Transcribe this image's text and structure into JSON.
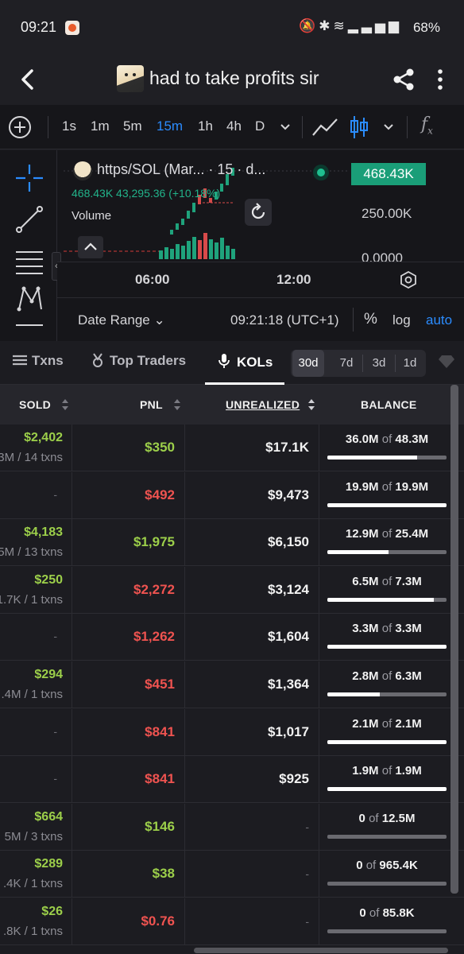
{
  "status": {
    "time": "09:21",
    "battery": "68%"
  },
  "header": {
    "title": "had to take profits sir"
  },
  "toolbar": {
    "timeframes": [
      "1s",
      "1m",
      "5m",
      "15m",
      "1h",
      "4h",
      "D"
    ],
    "active_timeframe": "15m"
  },
  "chart": {
    "legend_name": "https/SOL (Mar...  · 15 · d...",
    "legend_values": "468.43K  43,295.36 (+10.18%)",
    "volume_label": "Volume",
    "price_tag": "468.43K",
    "y_axis": [
      "250.00K",
      "0.0000"
    ],
    "time_axis": [
      "06:00",
      "12:00"
    ],
    "date_range": "Date Range",
    "clock": "09:21:18 (UTC+1)",
    "percent": "%",
    "log": "log",
    "auto": "auto",
    "accent": "#2b8cff",
    "up_color": "#1fbf8f",
    "down_color": "#ef5350"
  },
  "tabs": {
    "items": [
      "Txns",
      "Top Traders",
      "KOLs"
    ],
    "active": "KOLs",
    "periods": [
      "30d",
      "7d",
      "3d",
      "1d"
    ],
    "active_period": "30d"
  },
  "table": {
    "headers": {
      "sold": "SOLD",
      "pnl": "PNL",
      "unrealized": "UNREALIZED",
      "balance": "BALANCE"
    },
    "of_word": "of",
    "rows": [
      {
        "sold": "$2,402",
        "sold_sub": "3M / 14 txns",
        "pnl": "$350",
        "pnl_sign": "pos",
        "unrealized": "$17.1K",
        "bal_held": "36.0M",
        "bal_total": "48.3M",
        "bal_frac": 0.75
      },
      {
        "sold": "-",
        "sold_sub": "",
        "pnl": "$492",
        "pnl_sign": "neg",
        "unrealized": "$9,473",
        "bal_held": "19.9M",
        "bal_total": "19.9M",
        "bal_frac": 1.0
      },
      {
        "sold": "$4,183",
        "sold_sub": "5M / 13 txns",
        "pnl": "$1,975",
        "pnl_sign": "pos",
        "unrealized": "$6,150",
        "bal_held": "12.9M",
        "bal_total": "25.4M",
        "bal_frac": 0.51
      },
      {
        "sold": "$250",
        "sold_sub": "1.7K / 1 txns",
        "pnl": "$2,272",
        "pnl_sign": "neg",
        "unrealized": "$3,124",
        "bal_held": "6.5M",
        "bal_total": "7.3M",
        "bal_frac": 0.89
      },
      {
        "sold": "-",
        "sold_sub": "",
        "pnl": "$1,262",
        "pnl_sign": "neg",
        "unrealized": "$1,604",
        "bal_held": "3.3M",
        "bal_total": "3.3M",
        "bal_frac": 1.0
      },
      {
        "sold": "$294",
        "sold_sub": ".4M / 1 txns",
        "pnl": "$451",
        "pnl_sign": "neg",
        "unrealized": "$1,364",
        "bal_held": "2.8M",
        "bal_total": "6.3M",
        "bal_frac": 0.44
      },
      {
        "sold": "-",
        "sold_sub": "",
        "pnl": "$841",
        "pnl_sign": "neg",
        "unrealized": "$1,017",
        "bal_held": "2.1M",
        "bal_total": "2.1M",
        "bal_frac": 1.0
      },
      {
        "sold": "-",
        "sold_sub": "",
        "pnl": "$841",
        "pnl_sign": "neg",
        "unrealized": "$925",
        "bal_held": "1.9M",
        "bal_total": "1.9M",
        "bal_frac": 1.0
      },
      {
        "sold": "$664",
        "sold_sub": "5M / 3 txns",
        "pnl": "$146",
        "pnl_sign": "pos",
        "unrealized": "-",
        "bal_held": "0",
        "bal_total": "12.5M",
        "bal_frac": 0
      },
      {
        "sold": "$289",
        "sold_sub": ".4K / 1 txns",
        "pnl": "$38",
        "pnl_sign": "pos",
        "unrealized": "-",
        "bal_held": "0",
        "bal_total": "965.4K",
        "bal_frac": 0
      },
      {
        "sold": "$26",
        "sold_sub": ".8K / 1 txns",
        "pnl": "$0.76",
        "pnl_sign": "neg",
        "unrealized": "-",
        "bal_held": "0",
        "bal_total": "85.8K",
        "bal_frac": 0
      }
    ]
  }
}
